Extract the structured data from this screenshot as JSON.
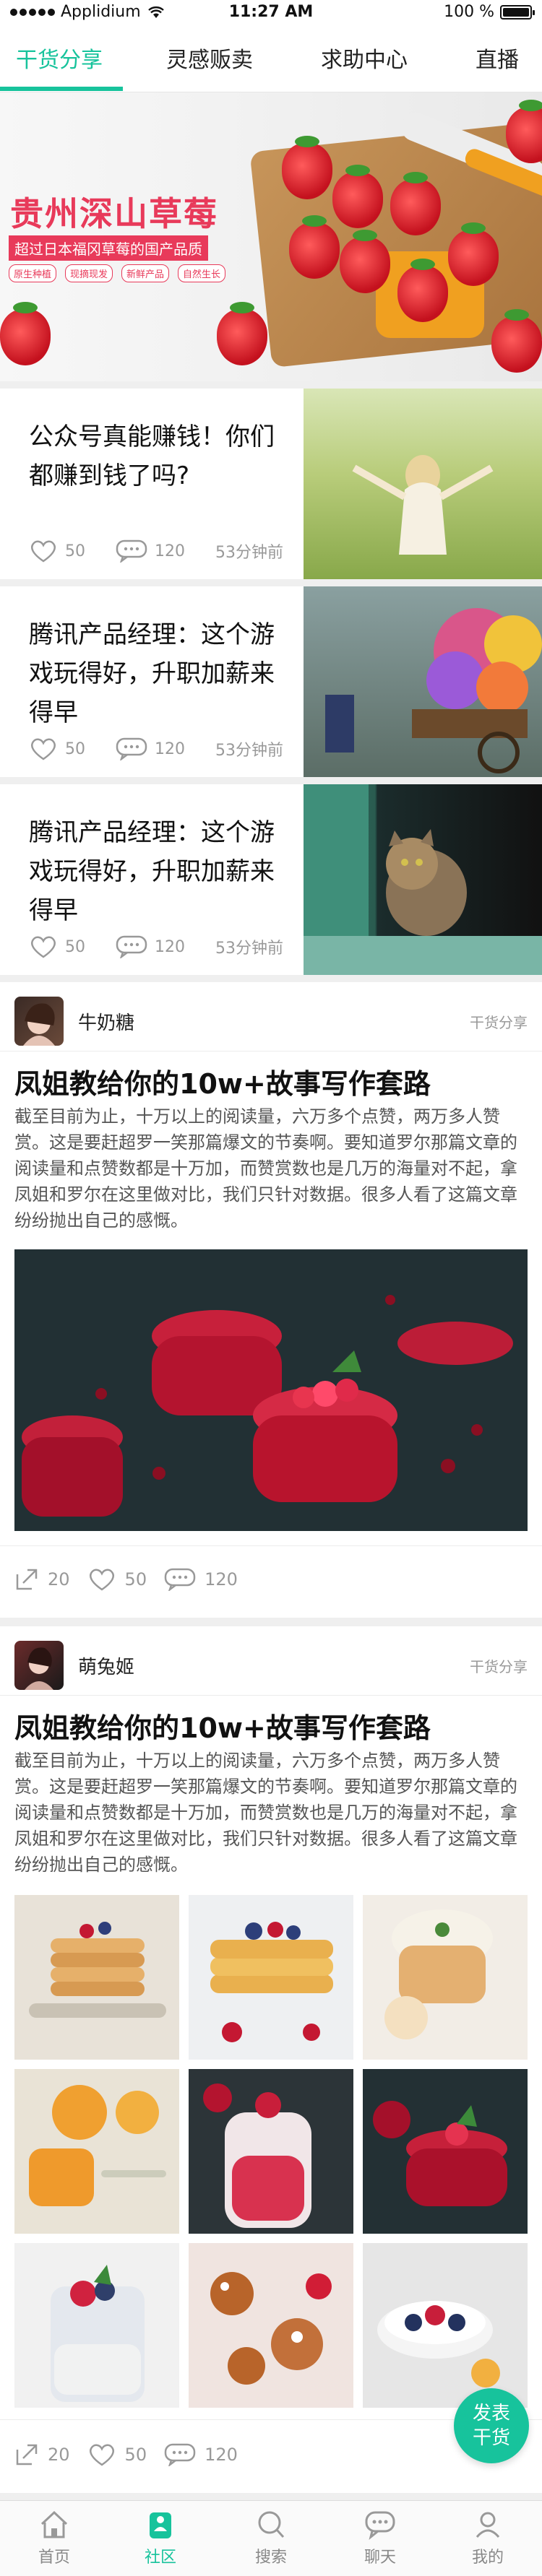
{
  "status": {
    "carrier": "Applidium",
    "time": "11:27 AM",
    "battery": "100 %"
  },
  "tabs": [
    {
      "label": "干货分享",
      "active": true
    },
    {
      "label": "灵感贩卖"
    },
    {
      "label": "求助中心"
    },
    {
      "label": "直播"
    }
  ],
  "banner": {
    "title_a": "贵州",
    "title_b": "深山草莓",
    "subtitle": "超过日本福冈草莓的国产品质",
    "chips": [
      "原生种植",
      "现摘现发",
      "新鲜产品",
      "自然生长"
    ]
  },
  "news": [
    {
      "title": "公众号真能赚钱！你们都赚到钱了吗?",
      "likes": "50",
      "comments": "120",
      "time": "53分钟前"
    },
    {
      "title": "腾讯产品经理：这个游戏玩得好，升职加薪来得早",
      "likes": "50",
      "comments": "120",
      "time": "53分钟前"
    },
    {
      "title": "腾讯产品经理：这个游戏玩得好，升职加薪来得早",
      "likes": "50",
      "comments": "120",
      "time": "53分钟前"
    }
  ],
  "posts": [
    {
      "author": "牛奶糖",
      "category": "干货分享",
      "title": "凤姐教给你的10w+故事写作套路",
      "body": "截至目前为止，十万以上的阅读量，六万多个点赞，两万多人赞赏。这是要赶超罗一笑那篇爆文的节奏啊。要知道罗尔那篇文章的阅读量和点赞数都是十万加，而赞赏数也是几万的海量对不起，拿凤姐和罗尔在这里做对比，我们只针对数据。很多人看了这篇文章纷纷抛出自己的感慨。",
      "shares": "20",
      "likes": "50",
      "comments": "120"
    },
    {
      "author": "萌兔姬",
      "category": "干货分享",
      "title": "凤姐教给你的10w+故事写作套路",
      "body": "截至目前为止，十万以上的阅读量，六万多个点赞，两万多人赞赏。这是要赶超罗一笑那篇爆文的节奏啊。要知道罗尔那篇文章的阅读量和点赞数都是十万加，而赞赏数也是几万的海量对不起，拿凤姐和罗尔在这里做对比，我们只针对数据。很多人看了这篇文章纷纷抛出自己的感慨。",
      "shares": "20",
      "likes": "50",
      "comments": "120"
    }
  ],
  "fab": {
    "line1": "发表",
    "line2": "干货"
  },
  "tabbar": [
    {
      "label": "首页"
    },
    {
      "label": "社区",
      "active": true
    },
    {
      "label": "搜索"
    },
    {
      "label": "聊天"
    },
    {
      "label": "我的"
    }
  ],
  "colors": {
    "accent": "#17c39c",
    "banner_red": "#e83a5a"
  }
}
